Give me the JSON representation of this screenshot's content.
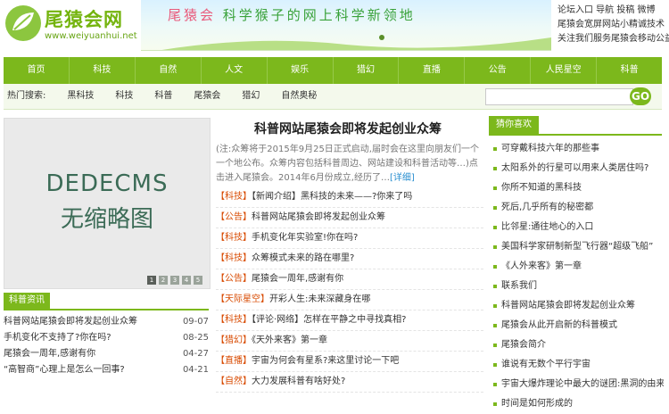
{
  "logo": {
    "name": "尾猿会网",
    "url": "www.weiyuanhui.net"
  },
  "banner": {
    "pre": "尾猿会",
    "text": "科学猴子的网上科学新领地"
  },
  "top_links": [
    "论坛入口 导航 投稿 微博",
    "尾猿会宽屏网站小精诚技术",
    "关注我们服务尾猿会移动公益"
  ],
  "main_nav": [
    "首页",
    "科技",
    "自然",
    "人文",
    "娱乐",
    "猎幻",
    "直播",
    "公告",
    "人民星空",
    "科普"
  ],
  "sub_nav": [
    "热门搜索:",
    "黑科技",
    "科技",
    "科普",
    "尾猿会",
    "猎幻",
    "自然奥秘"
  ],
  "search": {
    "placeholder": "",
    "button": "GO"
  },
  "slide": {
    "line1": "DEDECMS",
    "line2": "无缩略图",
    "dots": [
      "1",
      "2",
      "3",
      "4",
      "5"
    ]
  },
  "left_section": {
    "title": "科普资讯",
    "items": [
      {
        "title": "科普网站尾猿会即将发起创业众筹",
        "date": "09-07"
      },
      {
        "title": "手机变化不支持了?你在吗?",
        "date": "08-25"
      },
      {
        "title": "尾猿会一周年,感谢有你",
        "date": "04-27"
      },
      {
        "title": "“高智商”心理上是怎么一回事?",
        "date": "04-21"
      }
    ]
  },
  "headline": "科普网站尾猿会即将发起创业众筹",
  "summary": {
    "text": "(注:众筹将于2015年9月25日正式启动,届时会在这里向朋友们一个一个地公布。众筹内容包括科普周边、网站建设和科普活动等…)点击进入尾猿会。2014年6月份成立,经历了…",
    "more": "[详细]"
  },
  "center_list": [
    {
      "cat": "【科技】",
      "title": "【新闻介绍】黑科技的未来——?你来了吗"
    },
    {
      "cat": "【公告】",
      "title": "科普网站尾猿会即将发起创业众筹"
    },
    {
      "cat": "【科技】",
      "title": "手机变化年实验室!你在吗?"
    },
    {
      "cat": "【科技】",
      "title": "众筹模式未来的路在哪里?"
    },
    {
      "cat": "【公告】",
      "title": "尾猿会一周年,感谢有你"
    },
    {
      "cat": "【天际星空】",
      "title": "开彩人生:未来深藏身在哪"
    },
    {
      "cat": "【科技】",
      "title": "【评论·网络】怎样在平静之中寻找真相?"
    },
    {
      "cat": "【猎幻】",
      "title": "《天外来客》第一章"
    },
    {
      "cat": "【直播】",
      "title": "宇宙为何会有星系?来这里讨论一下吧"
    },
    {
      "cat": "【自然】",
      "title": "大力发展科普有啥好处?"
    }
  ],
  "right_section": {
    "title": "猜你喜欢",
    "items": [
      "可穿戴科技六年的那些事",
      "太阳系外的行星可以用来人类居住吗?",
      "你所不知道的黑科技",
      "死后,几乎所有的秘密都",
      "比邻星:通往地心的入口",
      "美国科学家研制新型飞行器“超级飞船”",
      "《人外来客》第一章",
      "联系我们",
      "科普网站尾猿会即将发起创业众筹",
      "尾猿会从此开启新的科普模式",
      "尾猿会简介",
      "谁说有无数个平行宇宙",
      "宇宙大爆炸理论中最大的谜团:黑洞的由来",
      "时间是如何形成的"
    ]
  }
}
